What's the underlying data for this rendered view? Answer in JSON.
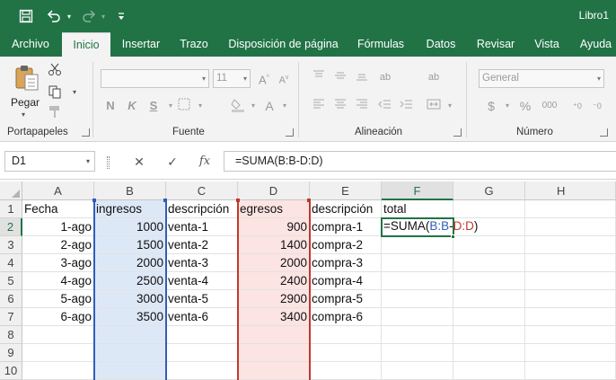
{
  "window": {
    "title": "Libro1"
  },
  "quick_access": {
    "save_icon": "save-icon",
    "undo_icon": "undo-icon",
    "redo_icon": "redo-icon",
    "customize_icon": "customize-icon"
  },
  "tabs": [
    {
      "label": "Archivo"
    },
    {
      "label": "Inicio"
    },
    {
      "label": "Insertar"
    },
    {
      "label": "Trazo"
    },
    {
      "label": "Disposición de página"
    },
    {
      "label": "Fórmulas"
    },
    {
      "label": "Datos"
    },
    {
      "label": "Revisar"
    },
    {
      "label": "Vista"
    },
    {
      "label": "Ayuda"
    }
  ],
  "ribbon": {
    "portapapeles": {
      "label": "Portapapeles",
      "paste_label": "Pegar"
    },
    "fuente": {
      "label": "Fuente",
      "font_size": "11",
      "bold": "N",
      "italic": "K",
      "underline": "S"
    },
    "alineacion": {
      "label": "Alineación"
    },
    "numero": {
      "label": "Número",
      "format": "General",
      "currency": "$",
      "percent": "%",
      "thousands": "000"
    }
  },
  "formula_bar": {
    "name_box": "D1",
    "cancel": "✕",
    "enter": "✓",
    "fx": "fx",
    "formula": "=SUMA(B:B-D:D)"
  },
  "columns": [
    "A",
    "B",
    "C",
    "D",
    "E",
    "F",
    "G",
    "H"
  ],
  "rows": [
    "1",
    "2",
    "3",
    "4",
    "5",
    "6",
    "7",
    "8",
    "9",
    "10"
  ],
  "sheet": {
    "headers": {
      "a": "Fecha",
      "b": "ingresos",
      "c": "descripción",
      "d": "egresos",
      "e": "descripción",
      "f": "total"
    },
    "data": [
      {
        "a": "1-ago",
        "b": "1000",
        "c": "venta-1",
        "d": "900",
        "e": "compra-1"
      },
      {
        "a": "2-ago",
        "b": "1500",
        "c": "venta-2",
        "d": "1400",
        "e": "compra-2"
      },
      {
        "a": "3-ago",
        "b": "2000",
        "c": "venta-3",
        "d": "2000",
        "e": "compra-3"
      },
      {
        "a": "4-ago",
        "b": "2500",
        "c": "venta-4",
        "d": "2400",
        "e": "compra-4"
      },
      {
        "a": "5-ago",
        "b": "3000",
        "c": "venta-5",
        "d": "2900",
        "e": "compra-5"
      },
      {
        "a": "6-ago",
        "b": "3500",
        "c": "venta-6",
        "d": "3400",
        "e": "compra-6"
      }
    ],
    "edit_cell": {
      "prefix": "=SUMA(",
      "ref1": "B:B",
      "minus": "-",
      "ref2": "D:D",
      "suffix": ")"
    }
  },
  "colors": {
    "brand": "#217346",
    "ref_b": "#2f5eb8",
    "ref_d": "#c0392b",
    "shade_b": "#dde8f7",
    "shade_d": "#fbe4e2"
  }
}
